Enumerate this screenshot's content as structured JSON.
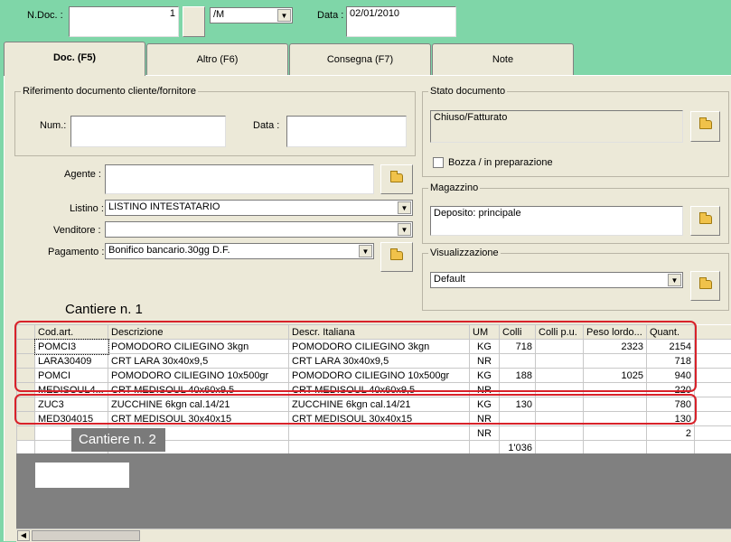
{
  "header": {
    "ndoc_label": "N.Doc. :",
    "ndoc_value": "1",
    "series_value": "/M",
    "data_label": "Data :",
    "data_value": "02/01/2010"
  },
  "tabs": [
    {
      "label": "Doc. (F5)"
    },
    {
      "label": "Altro (F6)"
    },
    {
      "label": "Consegna (F7)"
    },
    {
      "label": "Note"
    }
  ],
  "riferimento": {
    "title": "Riferimento documento cliente/fornitore",
    "num_label": "Num.:",
    "num_value": "",
    "data_label": "Data :",
    "data_value": ""
  },
  "stato": {
    "title": "Stato documento",
    "value": "Chiuso/Fatturato",
    "bozza_label": "Bozza / in preparazione",
    "bozza_checked": false
  },
  "agente": {
    "label": "Agente :",
    "value": ""
  },
  "listino": {
    "label": "Listino :",
    "value": "LISTINO INTESTATARIO"
  },
  "venditore": {
    "label": "Venditore :",
    "value": ""
  },
  "pagamento": {
    "label": "Pagamento :",
    "value": "Bonifico bancario.30gg D.F."
  },
  "magazzino": {
    "title": "Magazzino",
    "value": "Deposito: principale"
  },
  "visualizzazione": {
    "title": "Visualizzazione",
    "value": "Default"
  },
  "annotations": {
    "cantiere1": "Cantiere n. 1",
    "cantiere2": "Cantiere n. 2"
  },
  "grid": {
    "columns": [
      "",
      "Cod.art.",
      "Descrizione",
      "Descr. Italiana",
      "UM",
      "Colli",
      "Colli p.u.",
      "Peso lordo...",
      "Quant."
    ],
    "rows": [
      {
        "cod": "POMCI3",
        "desc": "POMODORO CILIEGINO 3kgn",
        "descr_it": "POMODORO CILIEGINO 3kgn",
        "um": "KG",
        "colli": "718",
        "colli_pu": "",
        "peso": "2323",
        "quant": "2154"
      },
      {
        "cod": "LARA30409",
        "desc": "CRT LARA 30x40x9,5",
        "descr_it": "CRT LARA 30x40x9,5",
        "um": "NR",
        "colli": "",
        "colli_pu": "",
        "peso": "",
        "quant": "718"
      },
      {
        "cod": "POMCI",
        "desc": "POMODORO CILIEGINO 10x500gr",
        "descr_it": "POMODORO CILIEGINO 10x500gr",
        "um": "KG",
        "colli": "188",
        "colli_pu": "",
        "peso": "1025",
        "quant": "940"
      },
      {
        "cod": "MEDISOUL4...",
        "desc": "CRT MEDISOUL 40x60x9,5",
        "descr_it": "CRT MEDISOUL 40x60x9,5",
        "um": "NR",
        "colli": "",
        "colli_pu": "",
        "peso": "",
        "quant": "220"
      },
      {
        "cod": "ZUC3",
        "desc": "ZUCCHINE   6kgn cal.14/21",
        "descr_it": "ZUCCHINE   6kgn cal.14/21",
        "um": "KG",
        "colli": "130",
        "colli_pu": "",
        "peso": "",
        "quant": "780"
      },
      {
        "cod": "MED304015",
        "desc": "CRT MEDISOUL 30x40x15",
        "descr_it": "CRT MEDISOUL 30x40x15",
        "um": "NR",
        "colli": "",
        "colli_pu": "",
        "peso": "",
        "quant": "130"
      },
      {
        "cod": "",
        "desc": "",
        "descr_it": "",
        "um": "NR",
        "colli": "",
        "colli_pu": "",
        "peso": "",
        "quant": "2"
      }
    ],
    "total_colli": "1'036"
  }
}
